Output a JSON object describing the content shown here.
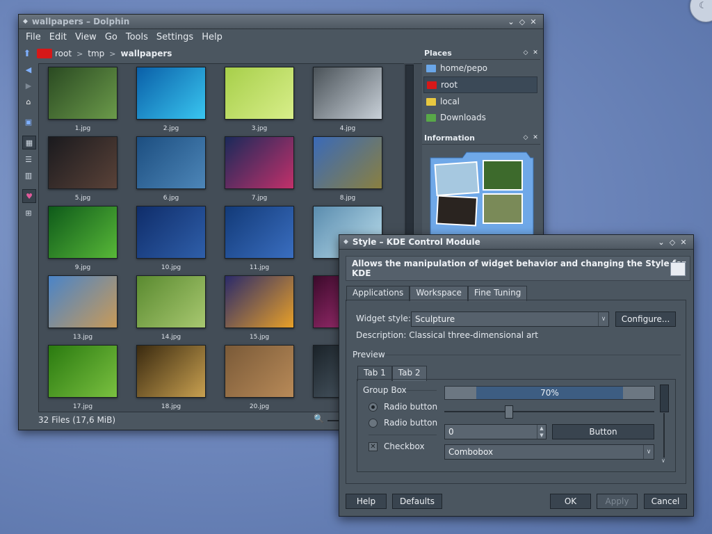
{
  "dolphin": {
    "title": "wallpapers – Dolphin",
    "menu": [
      "File",
      "Edit",
      "View",
      "Go",
      "Tools",
      "Settings",
      "Help"
    ],
    "breadcrumb": [
      "root",
      "tmp",
      "wallpapers"
    ],
    "files": [
      {
        "name": "1.jpg",
        "c1": "#2a4a22",
        "c2": "#6b9a4a"
      },
      {
        "name": "2.jpg",
        "c1": "#0a5fa8",
        "c2": "#39c6f0"
      },
      {
        "name": "3.jpg",
        "c1": "#a7cf4a",
        "c2": "#d8ee8a"
      },
      {
        "name": "4.jpg",
        "c1": "#4a5258",
        "c2": "#c8d0d8"
      },
      {
        "name": "5.jpg",
        "c1": "#1a1a1e",
        "c2": "#5a4238"
      },
      {
        "name": "6.jpg",
        "c1": "#1c4e80",
        "c2": "#4d86b8"
      },
      {
        "name": "7.jpg",
        "c1": "#1a2a5a",
        "c2": "#c2306a"
      },
      {
        "name": "8.jpg",
        "c1": "#3a6ab8",
        "c2": "#8a8040"
      },
      {
        "name": "9.jpg",
        "c1": "#0e5a1a",
        "c2": "#58b838"
      },
      {
        "name": "10.jpg",
        "c1": "#0f2d6a",
        "c2": "#2f5faa"
      },
      {
        "name": "11.jpg",
        "c1": "#123a78",
        "c2": "#3a6ec0"
      },
      {
        "name": "",
        "c1": "#5a8cae",
        "c2": "#bde0ee"
      },
      {
        "name": "13.jpg",
        "c1": "#4a84c8",
        "c2": "#c89a58"
      },
      {
        "name": "14.jpg",
        "c1": "#5a8a30",
        "c2": "#a8c870"
      },
      {
        "name": "15.jpg",
        "c1": "#2a2a6a",
        "c2": "#e8a028"
      },
      {
        "name": "",
        "c1": "#3a0a2a",
        "c2": "#c23a8a"
      },
      {
        "name": "17.jpg",
        "c1": "#2a7a10",
        "c2": "#7ac040"
      },
      {
        "name": "18.jpg",
        "c1": "#3a2a10",
        "c2": "#c8a050"
      },
      {
        "name": "20.jpg",
        "c1": "#7a5a38",
        "c2": "#b88a58"
      },
      {
        "name": "",
        "c1": "#1a2228",
        "c2": "#5a6a78"
      }
    ],
    "status": "32 Files (17,6 MiB)",
    "places": {
      "title": "Places",
      "items": [
        {
          "label": "home/pepo",
          "color": "#6aa6e8"
        },
        {
          "label": "root",
          "color": "#d61818",
          "selected": true
        },
        {
          "label": "local",
          "color": "#e8c840"
        },
        {
          "label": "Downloads",
          "color": "#58a848"
        }
      ]
    },
    "information": {
      "title": "Information"
    }
  },
  "kcm": {
    "title": "Style – KDE Control Module",
    "banner": "Allows the manipulation of widget behavior and changing the Style for KDE",
    "tabs": [
      "Applications",
      "Workspace",
      "Fine Tuning"
    ],
    "widget_style_label": "Widget style:",
    "widget_style_value": "Sculpture",
    "configure_label": "Configure...",
    "description": "Description: Classical three-dimensional art",
    "preview_label": "Preview",
    "preview_tabs": [
      "Tab 1",
      "Tab 2"
    ],
    "group_box_label": "Group Box",
    "radio1": "Radio button",
    "radio2": "Radio button",
    "checkbox": "Checkbox",
    "progress": {
      "value": 70,
      "label": "70%"
    },
    "spin_value": "0",
    "button_label": "Button",
    "combobox_label": "Combobox",
    "buttons": {
      "help": "Help",
      "defaults": "Defaults",
      "ok": "OK",
      "apply": "Apply",
      "cancel": "Cancel"
    }
  }
}
